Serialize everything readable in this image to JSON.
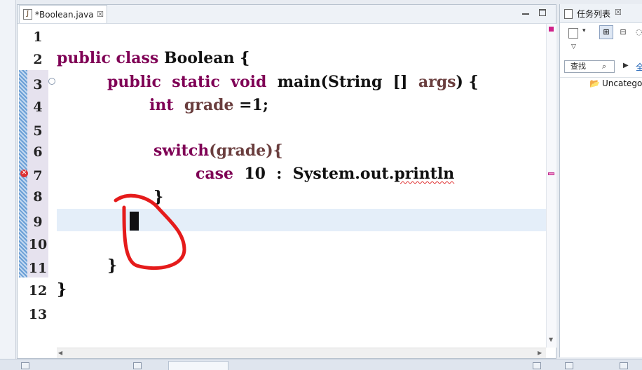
{
  "editor": {
    "tab_title": "*Boolean.java",
    "tab_icon": "java-file-icon",
    "close_glyph": "☒",
    "line_numbers": [
      "1",
      "2",
      "3",
      "4",
      "5",
      "6",
      "7",
      "8",
      "9",
      "10",
      "11",
      "12",
      "13"
    ],
    "code": {
      "line2": {
        "kw": "public class",
        "name": "Boolean",
        "brace": " {"
      },
      "line3": {
        "kw": "public  static  void",
        "name": "main(String  []",
        "arg": "args",
        "brace": ") {"
      },
      "line4": {
        "kw": "int",
        "var": "grade",
        "rest": " =1;"
      },
      "line6": {
        "kw": "switch",
        "rest": "(grade){"
      },
      "line7": {
        "kw": "case",
        "rest": "  10  :  System.out.",
        "err": "println"
      },
      "line8": "}",
      "line11": "}",
      "line12": "}"
    },
    "error_marker": "✕",
    "fold_marker": "⊖"
  },
  "task_panel": {
    "title": "任务列表",
    "close_glyph": "☒",
    "find_label": "查找",
    "find_icon": "⌕",
    "play_icon": "▶",
    "all_label": "全",
    "dropdown_icon": "▾",
    "menu_icon": "▽",
    "category_icon": "⊞",
    "schedule_icon": "⊟",
    "filter_icon": "◌",
    "folder_icon": "📂",
    "category_item": "Uncategorized"
  },
  "colors": {
    "keyword": "#7f0055",
    "identifier": "#6a3e3e",
    "current_line": "#e4eef9",
    "annotation": "#e51b1b"
  }
}
